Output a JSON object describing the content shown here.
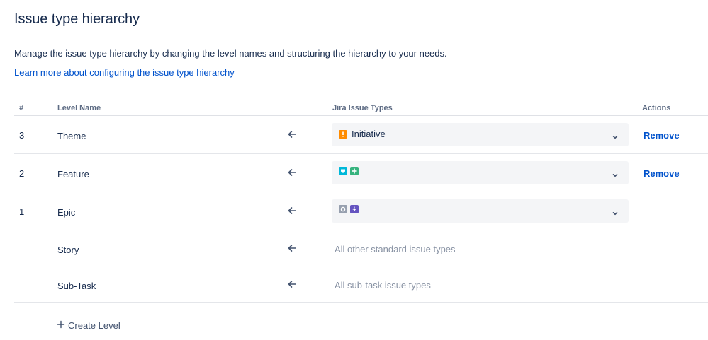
{
  "page": {
    "title": "Issue type hierarchy",
    "description": "Manage the issue type hierarchy by changing the level names and structuring the hierarchy to your needs.",
    "learn_more": "Learn more about configuring the issue type hierarchy"
  },
  "table": {
    "headers": {
      "num": "#",
      "level_name": "Level Name",
      "jira_types": "Jira Issue Types",
      "actions": "Actions"
    },
    "rows": [
      {
        "num": "3",
        "name": "Theme",
        "types": [
          {
            "icon": "initiative-icon",
            "color": "#ff8b00"
          }
        ],
        "type_label": "Initiative",
        "action": "Remove"
      },
      {
        "num": "2",
        "name": "Feature",
        "types": [
          {
            "icon": "feature-icon",
            "color": "#00b8d9"
          },
          {
            "icon": "improvement-icon",
            "color": "#36b37e"
          }
        ],
        "type_label": "",
        "action": "Remove"
      },
      {
        "num": "1",
        "name": "Epic",
        "types": [
          {
            "icon": "epic-icon",
            "color": "#97a0af"
          },
          {
            "icon": "epic-purple-icon",
            "color": "#6554c0"
          }
        ],
        "type_label": "",
        "action": ""
      },
      {
        "num": "",
        "name": "Story",
        "muted": "All other standard issue types"
      },
      {
        "num": "",
        "name": "Sub-Task",
        "muted": "All sub-task issue types"
      }
    ]
  },
  "create_level": "Create Level",
  "colors": {
    "link": "#0052cc",
    "text": "#172b4d",
    "muted": "#8993a4",
    "select_bg": "#f4f5f7"
  }
}
